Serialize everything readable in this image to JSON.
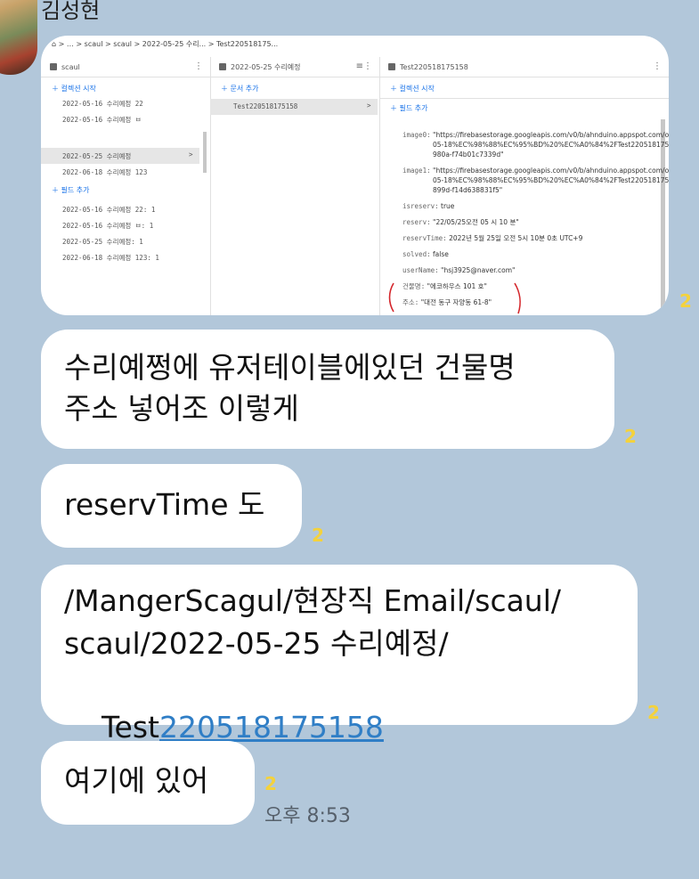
{
  "sender": "김성현",
  "screenshot": {
    "breadcrumb": [
      "…",
      "scaul",
      "scaul",
      "2022-05-25 수리...",
      "Test220518175..."
    ],
    "pane1": {
      "title": "scaul",
      "start_collection": "컬렉션 시작",
      "docs": [
        "2022-05-16 수리예정 22",
        "2022-05-16 수리예정 ㅂ",
        "2022-05-25 수리예정",
        "2022-06-18 수리예정 123"
      ],
      "add_field": "필드 추가",
      "fields": [
        "2022-05-16 수리예정 22: 1",
        "2022-05-16 수리예정 ㅂ: 1",
        "2022-05-25 수리예정: 1",
        "2022-06-18 수리예정 123: 1"
      ]
    },
    "pane2": {
      "title": "2022-05-25 수리예정",
      "add_doc": "문서 추가",
      "doc": "Test220518175158"
    },
    "pane3": {
      "title": "Test220518175158",
      "start_collection": "컬렉션 시작",
      "add_field": "필드 추가",
      "fields": [
        {
          "key": "image0:",
          "value": "\"https://firebasestorage.googleapis.com/v0/b/ahnduino.appspot.com/o...\n05-18%EC%98%88%EC%95%BD%20%EC%A0%84%2FTest220518175158\n980a-f74b01c7339d\""
        },
        {
          "key": "image1:",
          "value": "\"https://firebasestorage.googleapis.com/v0/b/ahnduino.appspot.com/o...\n05-18%EC%98%88%EC%95%BD%20%EC%A0%84%2FTest220518175158\n899d-f14d638831f5\""
        },
        {
          "key": "isreserv:",
          "value": "true"
        },
        {
          "key": "reserv:",
          "value": "\"22/05/25오전 05 시 10 분\""
        },
        {
          "key": "reservTime:",
          "value": "2022년 5월 25일 오전 5시 10분 0초 UTC+9"
        },
        {
          "key": "solved:",
          "value": "false"
        },
        {
          "key": "userName:",
          "value": "\"hsj3925@naver.com\""
        },
        {
          "key": "건물명:",
          "value": "\"에코하우스 101 호\""
        },
        {
          "key": "주소:",
          "value": "\"대전 동구 자양동 61-8\""
        }
      ]
    }
  },
  "messages": [
    {
      "text": "수리예쩡에 유저테이블에있던 건물명\n주소 넣어조 이렇게",
      "unread": "2"
    },
    {
      "text": "reservTime 도",
      "unread": "2"
    },
    {
      "text_line1": "/MangerScagul/현장직 Email/scaul/",
      "text_line2": "scaul/2022-05-25 수리예정/",
      "text_line3_prefix": "Test",
      "text_line3_link": "220518175158",
      "unread": "2"
    },
    {
      "text": "여기에 있어",
      "unread": "2"
    }
  ],
  "screenshot_unread": "2",
  "time": "오후 8:53"
}
